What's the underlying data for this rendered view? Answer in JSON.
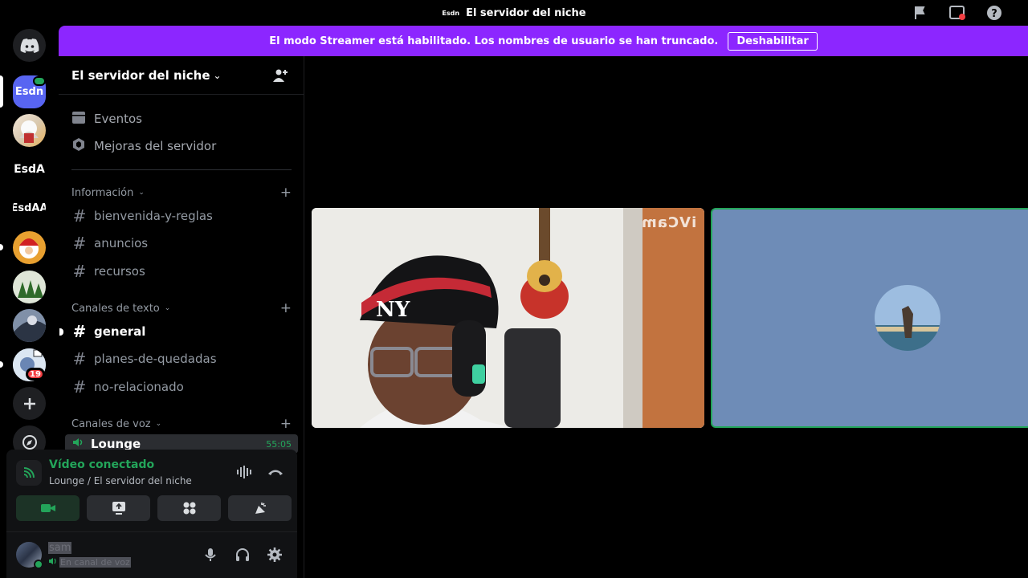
{
  "titlebar": {
    "server_mini": "Esdn",
    "title": "El servidor del niche"
  },
  "banner": {
    "text": "El modo Streamer está habilitado. Los nombres de usuario se han truncado.",
    "button": "Deshabilitar"
  },
  "guilds": {
    "items": [
      {
        "label": "Esdn",
        "badge": "",
        "color": "#5865f2"
      },
      {
        "label": "",
        "badge": ""
      },
      {
        "label": "EsdA",
        "badge": ""
      },
      {
        "label": "EsdAA",
        "badge": ""
      },
      {
        "label": "",
        "badge": ""
      },
      {
        "label": "",
        "badge": ""
      },
      {
        "label": "",
        "badge": ""
      },
      {
        "label": "",
        "badge": "19"
      }
    ]
  },
  "server": {
    "name": "El servidor del niche"
  },
  "sidebar": {
    "events": "Eventos",
    "boosts": "Mejoras del servidor",
    "categories": [
      {
        "name": "Información",
        "channels": [
          "bienvenida-y-reglas",
          "anuncios",
          "recursos"
        ]
      },
      {
        "name": "Canales de texto",
        "channels": [
          "general",
          "planes-de-quedadas",
          "no-relacionado"
        ]
      },
      {
        "name": "Canales de voz"
      }
    ],
    "voice_channel": {
      "name": "Lounge",
      "timer": "55:05"
    }
  },
  "voice_panel": {
    "status": "Vídeo conectado",
    "sub": "Lounge / El servidor del niche"
  },
  "user_panel": {
    "username": "sam",
    "status": "En canal de voz"
  },
  "stage": {
    "watermark": "iVCam"
  },
  "colors": {
    "accent_banner": "#8c26ff",
    "connected_green": "#23a55a",
    "blurple": "#5865f2"
  }
}
